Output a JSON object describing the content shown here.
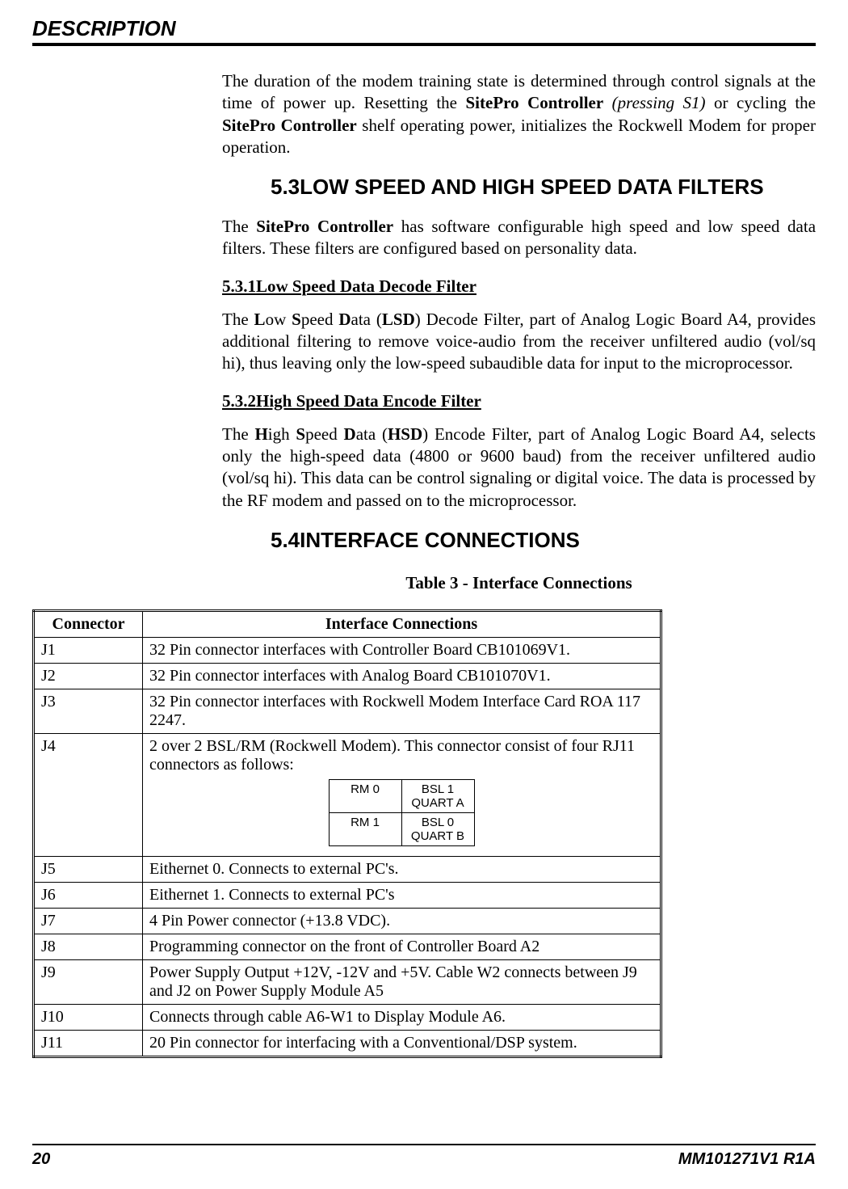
{
  "header": {
    "title": "DESCRIPTION"
  },
  "body": {
    "para1_pre": "The duration of the modem training state is determined through control signals at the time of power up. Resetting the ",
    "para1_b1": "SitePro Controller",
    "para1_i1": " (pressing S1)",
    "para1_mid": " or cycling the ",
    "para1_b2": "SitePro Controller",
    "para1_end": " shelf operating power, initializes the Rockwell Modem for proper operation.",
    "sec53": "5.3LOW SPEED AND HIGH SPEED DATA FILTERS",
    "para2_pre": "The ",
    "para2_b1": "SitePro Controller",
    "para2_end": " has software configurable high speed and low speed data filters. These filters are configured based on personality data.",
    "sub531": "5.3.1Low Speed Data Decode Filter",
    "para3_pre": "The ",
    "para3_L": "L",
    "para3_ow": "ow ",
    "para3_S": "S",
    "para3_peed": "peed ",
    "para3_D": "D",
    "para3_ata": "ata (",
    "para3_LSD": "LSD",
    "para3_end": ") Decode Filter, part of Analog Logic Board A4, provides additional filtering to remove voice-audio from the receiver unfiltered audio (vol/sq hi), thus leaving only the low-speed subaudible data for input to the microprocessor.",
    "sub532": "5.3.2High Speed Data Encode Filter",
    "para4_pre": "The ",
    "para4_H": "H",
    "para4_igh": "igh ",
    "para4_S": "S",
    "para4_peed": "peed ",
    "para4_D": "D",
    "para4_ata": "ata (",
    "para4_HSD": "HSD",
    "para4_end": ") Encode Filter, part of Analog Logic Board A4, selects only the high-speed data (4800 or 9600 baud) from the receiver unfiltered audio (vol/sq hi). This data can be control signaling or digital voice. The data is processed by the RF modem and passed on to the microprocessor.",
    "sec54": "5.4INTERFACE CONNECTIONS",
    "table_caption": "Table 3 - Interface Connections"
  },
  "table": {
    "head_connector": "Connector",
    "head_interface": "Interface Connections",
    "rows": {
      "j1c": "J1",
      "j1d": "32 Pin connector interfaces with Controller Board CB101069V1.",
      "j2c": "J2",
      "j2d": "32 Pin connector interfaces with Analog Board CB101070V1.",
      "j3c": "J3",
      "j3d": "32 Pin connector interfaces with Rockwell Modem Interface Card ROA 117 2247.",
      "j4c": "J4",
      "j4d": "2 over 2 BSL/RM (Rockwell Modem). This connector consist of four RJ11 connectors as follows:",
      "j5c": "J5",
      "j5d": "Eithernet 0. Connects to external PC's.",
      "j6c": "J6",
      "j6d": "Eithernet 1. Connects to external PC's",
      "j7c": "J7",
      "j7d": "4 Pin Power connector (+13.8 VDC).",
      "j8c": "J8",
      "j8d": "Programming connector on the front of Controller Board A2",
      "j9c": "J9",
      "j9d": "Power Supply Output +12V, -12V and +5V. Cable W2 connects between J9 and J2 on Power Supply Module A5",
      "j10c": "J10",
      "j10d": "Connects through cable A6-W1 to Display Module A6.",
      "j11c": "J11",
      "j11d": "20 Pin connector for interfacing with a Conventional/DSP system."
    },
    "inner": {
      "rm0": "RM 0",
      "bsl1a": "BSL 1",
      "bsl1b": "QUART A",
      "rm1": "RM 1",
      "bsl0a": "BSL 0",
      "bsl0b": "QUART B"
    }
  },
  "footer": {
    "page": "20",
    "docid": "MM101271V1 R1A"
  }
}
